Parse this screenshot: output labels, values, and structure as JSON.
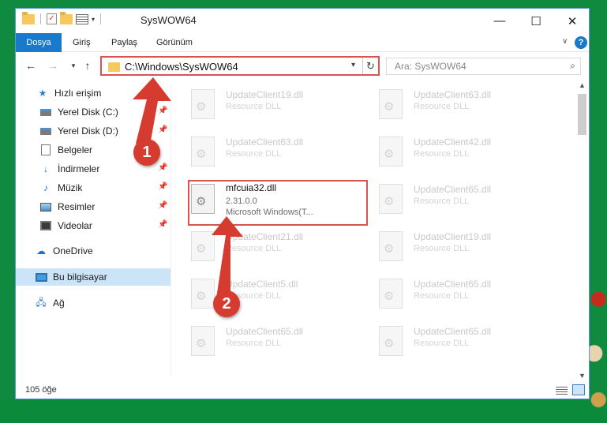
{
  "window": {
    "title": "SysWOW64",
    "minimize_glyph": "—",
    "maximize_glyph": "☐",
    "close_glyph": "✕"
  },
  "ribbon": {
    "tabs": [
      "Dosya",
      "Giriş",
      "Paylaş",
      "Görünüm"
    ],
    "help_glyph": "?"
  },
  "navigation": {
    "address_path": "C:\\Windows\\SysWOW64",
    "search_placeholder": "Ara: SysWOW64"
  },
  "sidebar": {
    "items": [
      {
        "label": "Hızlı erişim",
        "icon": "star-icon"
      },
      {
        "label": "Yerel Disk (C:)",
        "icon": "drive-icon"
      },
      {
        "label": "Yerel Disk (D:)",
        "icon": "drive-icon"
      },
      {
        "label": "Belgeler",
        "icon": "documents-icon"
      },
      {
        "label": "İndirmeler",
        "icon": "downloads-icon"
      },
      {
        "label": "Müzik",
        "icon": "music-icon"
      },
      {
        "label": "Resimler",
        "icon": "pictures-icon"
      },
      {
        "label": "Videolar",
        "icon": "videos-icon"
      },
      {
        "label": "OneDrive",
        "icon": "cloud-icon"
      },
      {
        "label": "Bu bilgisayar",
        "icon": "computer-icon"
      },
      {
        "label": "Ağ",
        "icon": "network-icon"
      }
    ]
  },
  "files": [
    {
      "name": "UpdateClient19.dll",
      "desc": "Resource DLL"
    },
    {
      "name": "UpdateClient63.dll",
      "desc": "Resource DLL"
    },
    {
      "name": "UpdateClient63.dll",
      "desc": "Resource DLL"
    },
    {
      "name": "UpdateClient42.dll",
      "desc": "Resource DLL"
    },
    {
      "name": "mfcuia32.dll",
      "desc": "2.31.0.0",
      "desc2": "Microsoft Windows(T..."
    },
    {
      "name": "UpdateClient65.dll",
      "desc": "Resource DLL"
    },
    {
      "name": "UpdateClient21.dll",
      "desc": "Resource DLL"
    },
    {
      "name": "UpdateClient19.dll",
      "desc": "Resource DLL"
    },
    {
      "name": "UpdateClient5.dll",
      "desc": "Resource DLL"
    },
    {
      "name": "UpdateClient65.dll",
      "desc": "Resource DLL"
    },
    {
      "name": "UpdateClient65.dll",
      "desc": "Resource DLL"
    },
    {
      "name": "UpdateClient65.dll",
      "desc": "Resource DLL"
    }
  ],
  "status": {
    "item_count": "105 öğe"
  },
  "callouts": [
    "1",
    "2"
  ],
  "colors": {
    "accent": "#1979ca",
    "highlight": "#d9534f",
    "callout": "#d63b2f"
  }
}
